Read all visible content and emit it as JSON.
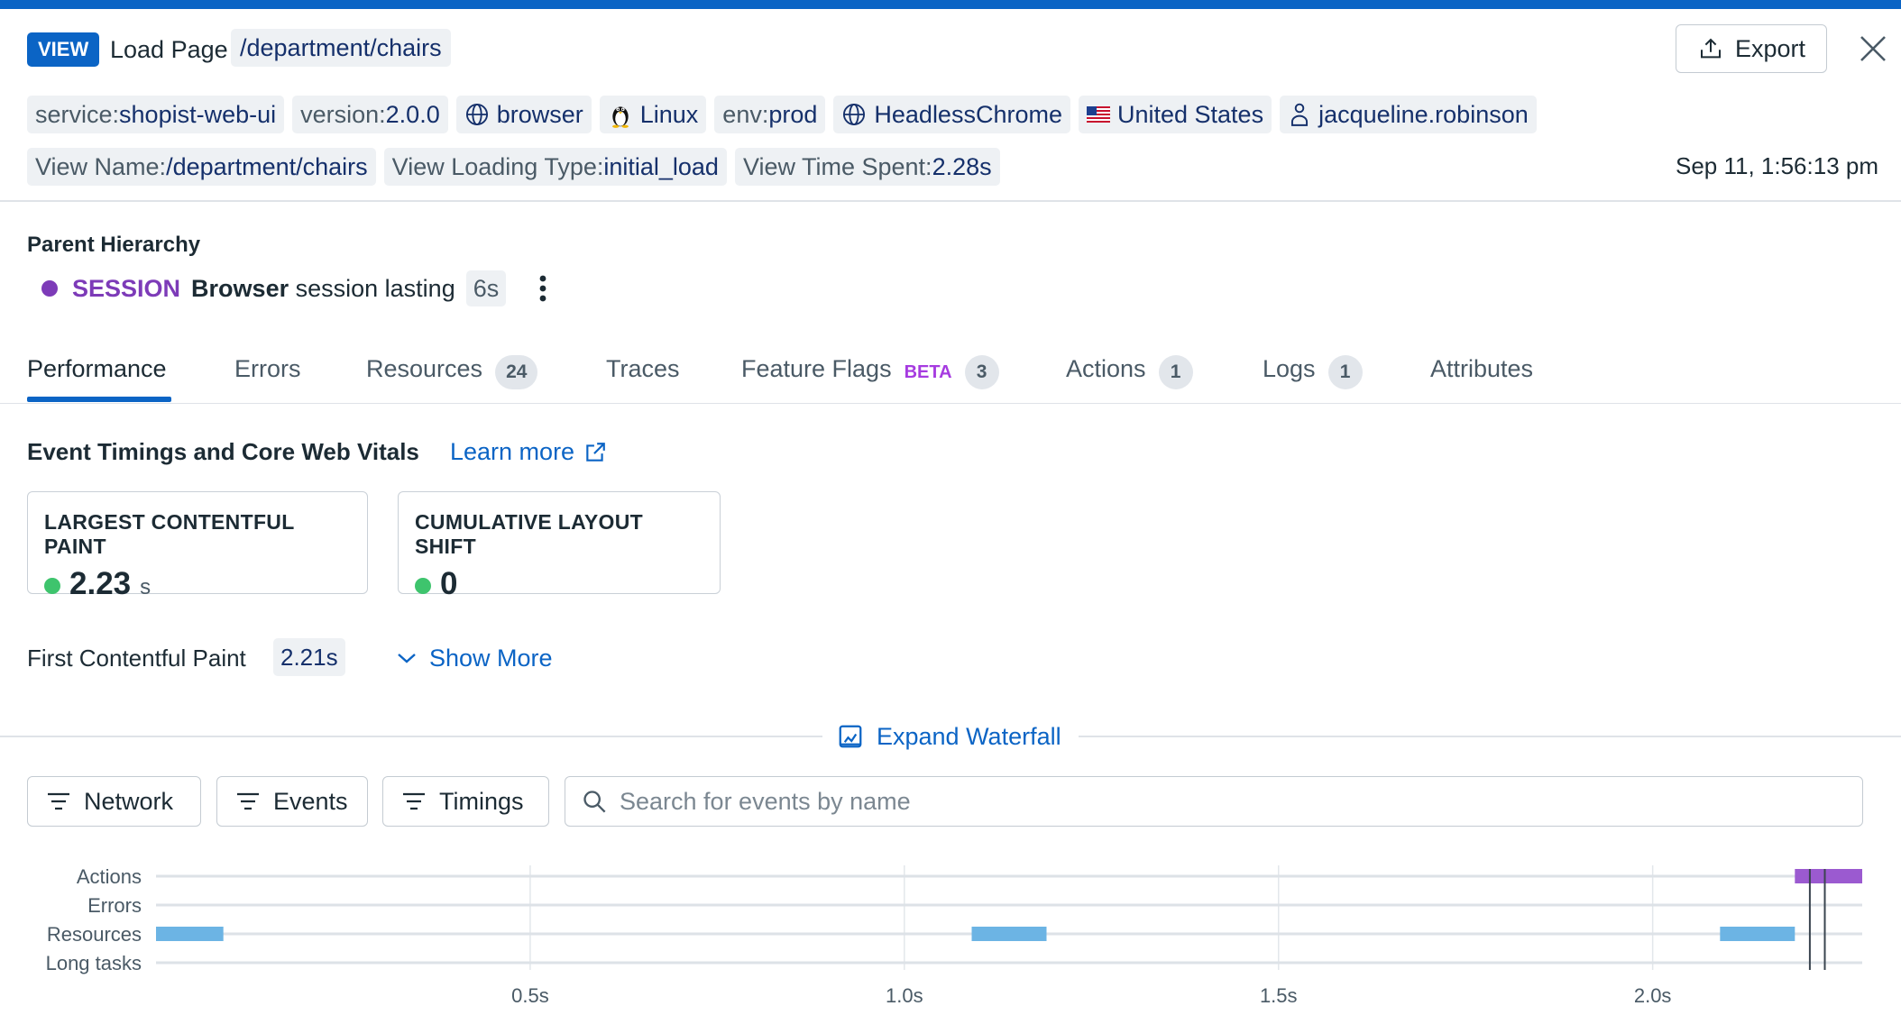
{
  "colors": {
    "accent": "#0b64c5",
    "session": "#7d3bb8",
    "good": "#3ec46d",
    "resource_bar": "#6cb4e4",
    "action_bar": "#9b5ad0"
  },
  "header": {
    "badge": "VIEW",
    "title": "Load Page",
    "url": "/department/chairs",
    "export_label": "Export",
    "timestamp": "Sep 11, 1:56:13 pm"
  },
  "tags": {
    "service_key": "service:",
    "service_val": "shopist-web-ui",
    "version_key": "version:",
    "version_val": "2.0.0",
    "browser": "browser",
    "os": "Linux",
    "env_key": "env:",
    "env_val": "prod",
    "browser_name": "HeadlessChrome",
    "country": "United States",
    "user": "jacqueline.robinson",
    "viewname_key": "View Name:",
    "viewname_val": "/department/chairs",
    "loadtype_key": "View Loading Type:",
    "loadtype_val": "initial_load",
    "timespent_key": "View Time Spent:",
    "timespent_val": "2.28s"
  },
  "parent": {
    "title": "Parent Hierarchy",
    "type": "SESSION",
    "desc_bold": "Browser",
    "desc_rest": "session lasting",
    "duration": "6s"
  },
  "tabs": [
    {
      "label": "Performance"
    },
    {
      "label": "Errors"
    },
    {
      "label": "Resources",
      "count": "24"
    },
    {
      "label": "Traces"
    },
    {
      "label": "Feature Flags",
      "badge": "BETA",
      "count": "3"
    },
    {
      "label": "Actions",
      "count": "1"
    },
    {
      "label": "Logs",
      "count": "1"
    },
    {
      "label": "Attributes"
    }
  ],
  "vitals": {
    "section_title": "Event Timings and Core Web Vitals",
    "learn_more": "Learn more",
    "lcp_label": "LARGEST CONTENTFUL PAINT",
    "lcp_value": "2.23",
    "lcp_unit": "s",
    "cls_label": "CUMULATIVE LAYOUT SHIFT",
    "cls_value": "0",
    "fcp_label": "First Contentful Paint",
    "fcp_value": "2.21s",
    "show_more": "Show More"
  },
  "waterfall": {
    "expand_label": "Expand Waterfall",
    "filters": {
      "network": "Network",
      "events": "Events",
      "timings": "Timings"
    },
    "search_placeholder": "Search for events by name"
  },
  "chart_data": {
    "type": "timeline",
    "rows": [
      "Actions",
      "Errors",
      "Resources",
      "Long tasks"
    ],
    "x_ticks": [
      "0.5s",
      "1.0s",
      "1.5s",
      "2.0s"
    ],
    "x_tick_values": [
      0.5,
      1.0,
      1.5,
      2.0
    ],
    "xlim": [
      0,
      2.28
    ],
    "bars": [
      {
        "row": "Resources",
        "start": 0.0,
        "end": 0.09
      },
      {
        "row": "Resources",
        "start": 1.09,
        "end": 1.19
      },
      {
        "row": "Resources",
        "start": 2.09,
        "end": 2.19
      },
      {
        "row": "Actions",
        "start": 2.19,
        "end": 2.28
      }
    ],
    "markers": [
      2.21,
      2.23
    ]
  }
}
